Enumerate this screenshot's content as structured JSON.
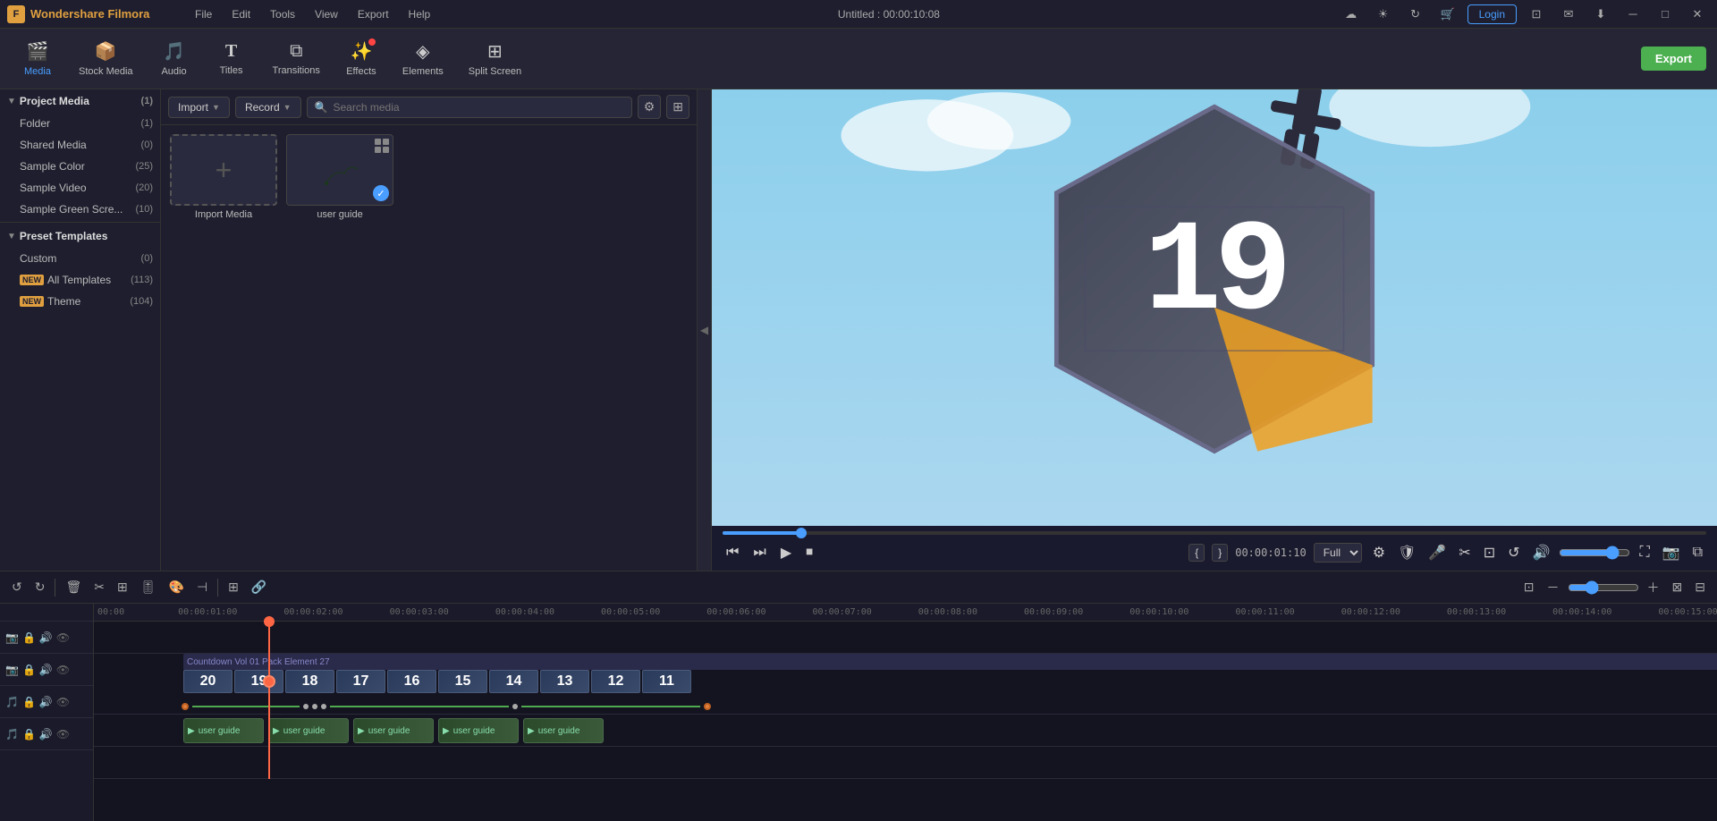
{
  "app": {
    "name": "Wondershare Filmora",
    "title": "Untitled : 00:00:10:08"
  },
  "titlebar": {
    "logo_text": "Wondershare Filmora",
    "menu_items": [
      "File",
      "Edit",
      "Tools",
      "View",
      "Export",
      "Help"
    ],
    "login_label": "Login",
    "title": "Untitled : 00:00:10:08"
  },
  "toolbar": {
    "items": [
      {
        "id": "media",
        "icon": "🎬",
        "label": "Media",
        "active": true
      },
      {
        "id": "stock",
        "icon": "📦",
        "label": "Stock Media",
        "active": false
      },
      {
        "id": "audio",
        "icon": "🎵",
        "label": "Audio",
        "active": false
      },
      {
        "id": "titles",
        "icon": "T",
        "label": "Titles",
        "active": false
      },
      {
        "id": "transitions",
        "icon": "⧉",
        "label": "Transitions",
        "active": false
      },
      {
        "id": "effects",
        "icon": "✨",
        "label": "Effects",
        "active": false,
        "badge": true
      },
      {
        "id": "elements",
        "icon": "◈",
        "label": "Elements",
        "active": false
      },
      {
        "id": "splitscreen",
        "icon": "⊞",
        "label": "Split Screen",
        "active": false
      }
    ],
    "export_label": "Export"
  },
  "left_panel": {
    "sections": [
      {
        "id": "project-media",
        "label": "Project Media",
        "count": 1,
        "expanded": true,
        "children": [
          {
            "id": "folder",
            "label": "Folder",
            "count": 1
          },
          {
            "id": "shared-media",
            "label": "Shared Media",
            "count": 0
          },
          {
            "id": "sample-color",
            "label": "Sample Color",
            "count": 25
          },
          {
            "id": "sample-video",
            "label": "Sample Video",
            "count": 20
          },
          {
            "id": "sample-green",
            "label": "Sample Green Scre...",
            "count": 10
          }
        ]
      },
      {
        "id": "preset-templates",
        "label": "Preset Templates",
        "count": null,
        "expanded": true,
        "children": [
          {
            "id": "custom",
            "label": "Custom",
            "count": 0
          },
          {
            "id": "all-templates",
            "label": "All Templates",
            "count": 113,
            "new": true
          },
          {
            "id": "theme",
            "label": "Theme",
            "count": 104,
            "new": true
          }
        ]
      }
    ]
  },
  "media_toolbar": {
    "import_label": "Import",
    "record_label": "Record",
    "search_placeholder": "Search media",
    "filter_icon": "filter",
    "grid_icon": "grid"
  },
  "media_grid": {
    "items": [
      {
        "id": "import",
        "type": "import",
        "name": "Import Media"
      },
      {
        "id": "user-guide",
        "type": "video",
        "name": "user guide"
      }
    ]
  },
  "preview": {
    "progress": 8,
    "timestamp": "00:00:01:10",
    "quality": "Full",
    "bracket_start": "{",
    "bracket_end": "}"
  },
  "timeline": {
    "toolbar_buttons": [
      "undo",
      "redo",
      "delete",
      "cut",
      "transform",
      "audio",
      "stabilize",
      "trim"
    ],
    "tracks": [
      {
        "id": "track1",
        "type": "video",
        "icons": [
          "camera",
          "lock",
          "audio",
          "eye"
        ]
      },
      {
        "id": "track2",
        "type": "video",
        "icons": [
          "camera",
          "lock",
          "audio",
          "eye"
        ]
      },
      {
        "id": "track3",
        "type": "audio",
        "icons": [
          "music",
          "lock",
          "audio",
          "eye"
        ]
      }
    ],
    "ruler_marks": [
      "00:00",
      "00:00:01:00",
      "00:00:02:00",
      "00:00:03:00",
      "00:00:04:00",
      "00:00:05:00",
      "00:00:06:00",
      "00:00:07:00",
      "00:00:08:00",
      "00:00:09:00",
      "00:00:10:00",
      "00:00:11:00",
      "00:00:12:00",
      "00:00:13:00",
      "00:00:14:00",
      "00:00:15:00"
    ],
    "countdown_clip": {
      "label": "Countdown Vol 01 Pack Element 27",
      "frames": [
        "20",
        "19",
        "18",
        "17",
        "16",
        "15",
        "14",
        "13",
        "12",
        "11"
      ]
    },
    "guide_clips": [
      "user guide",
      "user guide",
      "user guide",
      "user guide",
      "user guide"
    ]
  }
}
